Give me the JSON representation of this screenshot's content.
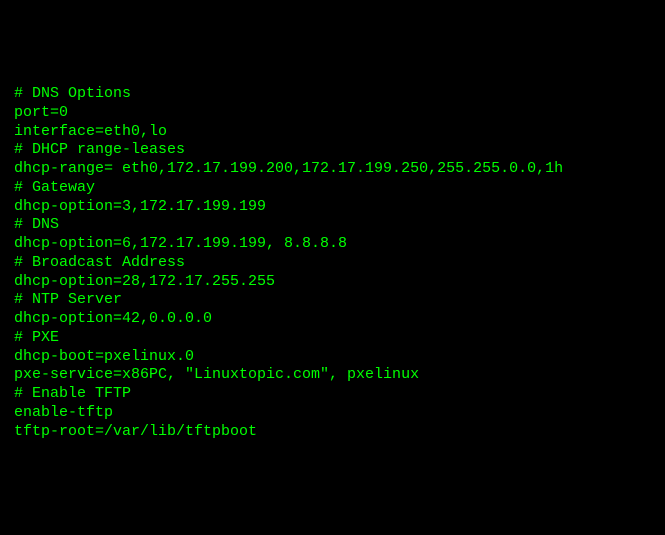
{
  "config": {
    "sections": [
      {
        "comment": "# DNS Options",
        "lines": [
          "port=0",
          "interface=eth0,lo"
        ]
      },
      {
        "comment": "# DHCP range-leases",
        "lines": [
          "dhcp-range= eth0,172.17.199.200,172.17.199.250,255.255.0.0,1h"
        ]
      },
      {
        "comment": "# Gateway",
        "lines": [
          "dhcp-option=3,172.17.199.199"
        ]
      },
      {
        "comment": "# DNS",
        "lines": [
          "dhcp-option=6,172.17.199.199, 8.8.8.8"
        ]
      },
      {
        "comment": "# Broadcast Address",
        "lines": [
          "dhcp-option=28,172.17.255.255"
        ]
      },
      {
        "comment": "# NTP Server",
        "lines": [
          "dhcp-option=42,0.0.0.0"
        ]
      },
      {
        "comment": "# PXE",
        "lines": [
          "dhcp-boot=pxelinux.0",
          "pxe-service=x86PC, \"Linuxtopic.com\", pxelinux"
        ]
      },
      {
        "comment": "# Enable TFTP",
        "lines": [
          "enable-tftp",
          "tftp-root=/var/lib/tftpboot"
        ]
      }
    ]
  }
}
